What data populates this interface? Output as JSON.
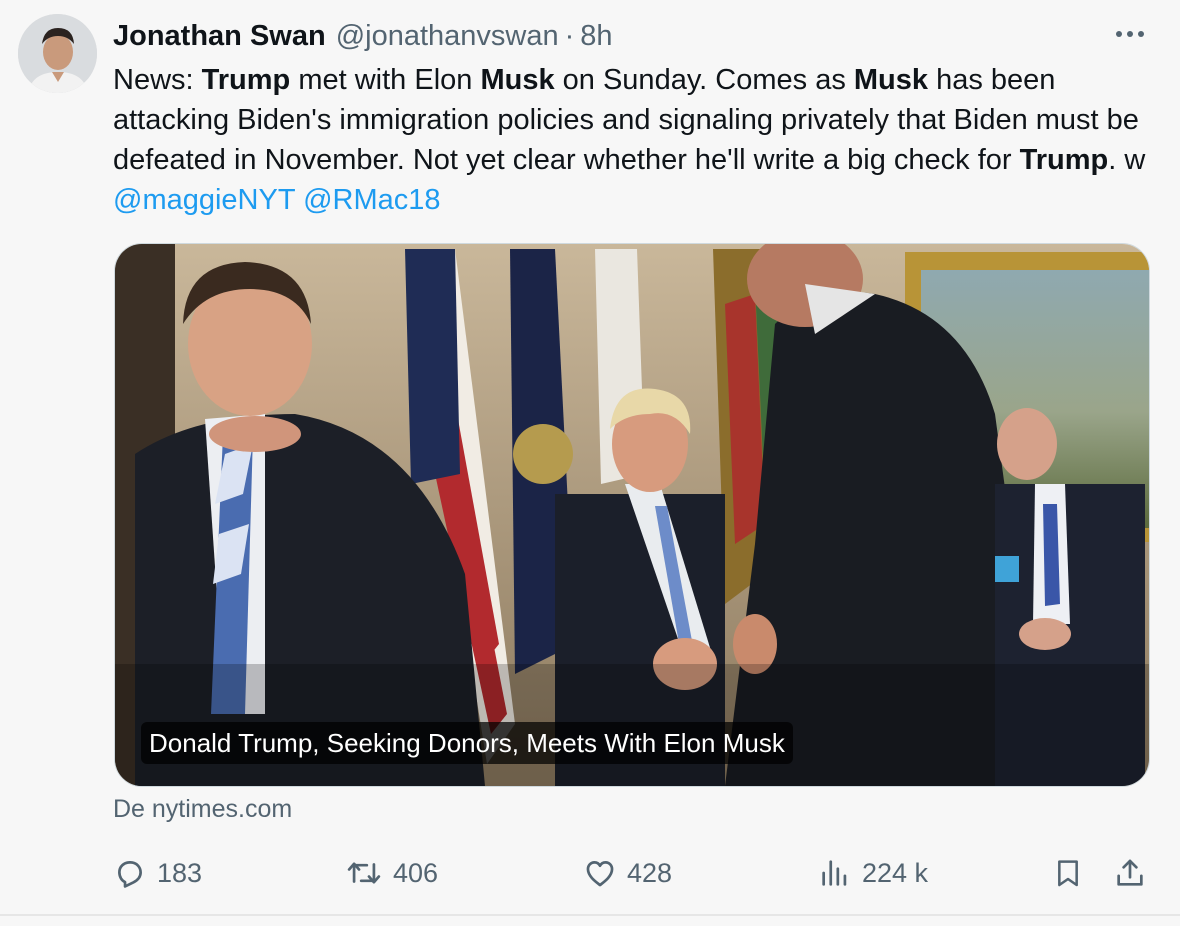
{
  "author": {
    "name": "Jonathan Swan",
    "handle": "@jonathanvswan",
    "separator": "·",
    "time": "8h",
    "avatar_icon": "user-avatar"
  },
  "tweet": {
    "t1": "News: ",
    "t2": "Trump",
    "t3": " met with Elon ",
    "t4": "Musk",
    "t5": " on Sunday. Comes as ",
    "t6": "Musk",
    "t7": " has been attacking Biden's immigration policies and signaling privately that Biden must be defeated in November. Not yet clear whether he'll write a big check for ",
    "t8": "Trump",
    "t9": ". w ",
    "mention1": "@maggieNYT",
    "mention2": "@RMac18"
  },
  "card": {
    "caption": "Donald Trump, Seeking Donors, Meets With Elon Musk",
    "source": "De nytimes.com"
  },
  "actions": {
    "replies": "183",
    "reposts": "406",
    "likes": "428",
    "views": "224 k"
  },
  "colors": {
    "link": "#1d9bf0",
    "muted": "#536471",
    "text": "#0f1419",
    "background": "#f7f7f7"
  }
}
